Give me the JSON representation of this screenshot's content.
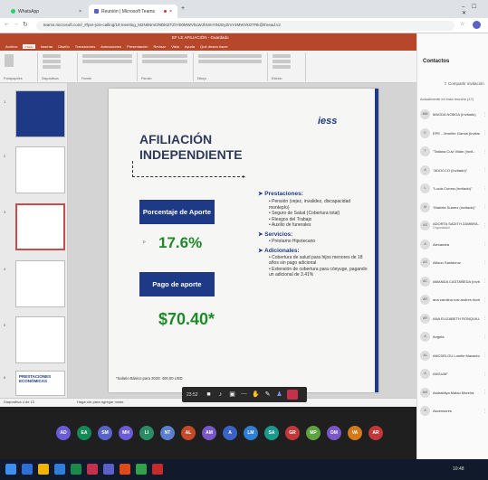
{
  "browser": {
    "tabs": [
      {
        "label": "WhatsApp"
      },
      {
        "label": "Reunión | Microsoft Teams"
      }
    ],
    "new_tab": "+",
    "url": "teams.microsoft.com/_#/pre-join-calling/19:meeting_M2NkNmI2NDktZTZiYi00MWVhLWJhNmYtNzEyZmY4MWVkOTRk@thread.v2"
  },
  "ppt": {
    "title": "EF LE AFILIACIÓN - Guardado",
    "ribbon_tabs": [
      "Archivo",
      "Inicio",
      "Insertar",
      "Diseño",
      "Transiciones",
      "Animaciones",
      "Presentación",
      "Revisar",
      "Vista",
      "Ayuda",
      "Qué desea hacer"
    ],
    "groups": [
      "Portapapeles",
      "Diapositivas",
      "Fuente",
      "Párrafo",
      "Dibujo",
      "Edición"
    ],
    "thumb_numbers": [
      "1",
      "2",
      "3",
      "4",
      "5",
      "6"
    ],
    "status_left": "Diapositiva 4 de 13",
    "notes_hint": "Haga clic para agregar notas"
  },
  "slide": {
    "title": "AFILIACIÓN INDEPENDIENTE",
    "logo": "iess",
    "box1": "Porcentaje de Aporte",
    "value1": "17.6%",
    "box2": "Pago de aporte",
    "value2": "$70.40*",
    "section1": {
      "heading": "Prestaciones:",
      "items": [
        "Pensión (vejez, invalidez, discapacidad montepío)",
        "Seguro de Salud (Cobertura total)",
        "Riesgos del Trabajo",
        "Auxilio de funerales"
      ]
    },
    "section2": {
      "heading": "Servicios:",
      "items": [
        "Préstamo Hipotecario"
      ]
    },
    "section3": {
      "heading": "Adicionales:",
      "items": [
        "Cobertura de salud para hijos menores de 18 años sin pago adicional",
        "Extensión de cobertura para cónyuge, pagando un adicional de 3.41%"
      ]
    },
    "footnote": "*Salario Básico para 2020: 400,00 USD"
  },
  "thumb_last": "PRESTACIONES ECONÓMICAS",
  "call": {
    "time": "23:52"
  },
  "participants_strip": [
    {
      "initials": "AD",
      "color": "#6b5bd6"
    },
    {
      "initials": "EA",
      "color": "#138a55"
    },
    {
      "initials": "SM",
      "color": "#5964c9"
    },
    {
      "initials": "MH",
      "color": "#6b5bd6"
    },
    {
      "initials": "LI",
      "color": "#2a8c67"
    },
    {
      "initials": "NT",
      "color": "#5a7fcf"
    },
    {
      "initials": "AL",
      "color": "#c54a2a"
    },
    {
      "initials": "AM",
      "color": "#7a57c6"
    },
    {
      "initials": "A",
      "color": "#3b63c7"
    },
    {
      "initials": "LM",
      "color": "#2f7fd6"
    },
    {
      "initials": "SA",
      "color": "#199a8c"
    },
    {
      "initials": "GR",
      "color": "#c2383a"
    },
    {
      "initials": "MP",
      "color": "#5da23e"
    },
    {
      "initials": "DM",
      "color": "#7a57c6"
    },
    {
      "initials": "VA",
      "color": "#d27a1b"
    },
    {
      "initials": "AR",
      "color": "#c2383a"
    }
  ],
  "side": {
    "title": "Contactos",
    "share": "Compartir invitación",
    "section": "Actualmente en esta reunión (17)",
    "people": [
      {
        "name": "MAGDA NOBOA (Invitado)",
        "init": "MM"
      },
      {
        "name": "EPE - Jennifer Garcia (Invitado)",
        "init": "E"
      },
      {
        "name": "\"Tatiana Cuvi Vilain (Invit...",
        "init": "T"
      },
      {
        "name": "\"ADOCCO (Invitado)\"",
        "init": "A"
      },
      {
        "name": "\"Lucia Correa (Invitado)\"",
        "init": "L"
      },
      {
        "name": "\"Mariela Suarez (Invitado)\"",
        "init": "M"
      },
      {
        "name": "ADORTA SADITH ZAMBRA...",
        "init": "AS",
        "role": "Organizador"
      },
      {
        "name": "Alexandra",
        "init": "A"
      },
      {
        "name": "Allison Santacruz",
        "init": "AS"
      },
      {
        "name": "AMANDA CASTAÑEDA (Invit...",
        "init": "AC"
      },
      {
        "name": "ana carolina rosi andres ricch...",
        "init": "AR"
      },
      {
        "name": "ANA ELIZABETH RONQUILL...",
        "init": "AR"
      },
      {
        "name": "Angela",
        "init": "A"
      },
      {
        "name": "ANCDELGU Lorelle Macacho",
        "init": "AL"
      },
      {
        "name": "ANGUAF",
        "init": "A"
      },
      {
        "name": "Asdraldiya Malao Moreira",
        "init": "AM"
      },
      {
        "name": "Ascensores",
        "init": "A"
      }
    ]
  },
  "taskbar": {
    "time": "10:48"
  }
}
